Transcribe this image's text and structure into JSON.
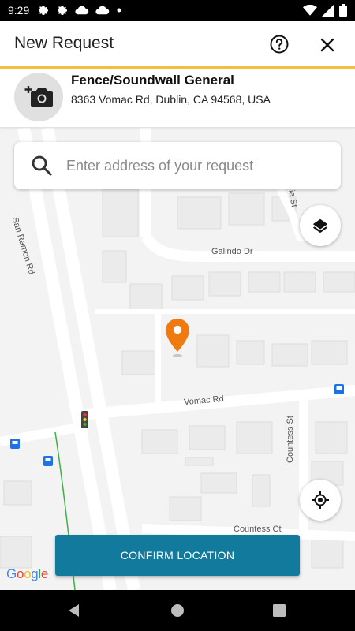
{
  "status_bar": {
    "time": "9:29",
    "icons": [
      "gear-icon",
      "gear-icon",
      "cloud-icon",
      "cloud-icon",
      "dot-icon"
    ],
    "right_icons": [
      "wifi-icon",
      "signal-icon",
      "battery-icon"
    ]
  },
  "app_bar": {
    "title": "New Request",
    "help_icon": "help-circle-icon",
    "close_icon": "close-icon",
    "accent_color": "#F5BE3E"
  },
  "request": {
    "title": "Fence/Soundwall General",
    "address": "8363 Vomac Rd, Dublin, CA 94568, USA",
    "photo_icon": "add-photo-icon"
  },
  "search": {
    "placeholder": "Enter address of your request",
    "value": ""
  },
  "map": {
    "street_labels": {
      "san_ramon": "San Ramon Rd",
      "galindo": "Galindo Dr",
      "vomac": "Vomac Rd",
      "countess_st": "Countess St",
      "countess_ct": "Countess Ct",
      "ia_st": "ia St"
    },
    "pin_color": "#EF7B10",
    "layers_icon": "layers-icon",
    "my_location_icon": "my-location-icon",
    "attribution": [
      "G",
      "o",
      "o",
      "g",
      "l",
      "e"
    ],
    "attribution_colors": [
      "#4285F4",
      "#EA4335",
      "#FBBC05",
      "#4285F4",
      "#34A853",
      "#EA4335"
    ]
  },
  "confirm_button": {
    "label": "CONFIRM LOCATION",
    "color": "#117A9D"
  },
  "nav_bar": {
    "back_icon": "back-triangle-icon",
    "home_icon": "home-circle-icon",
    "recents_icon": "recents-square-icon"
  }
}
